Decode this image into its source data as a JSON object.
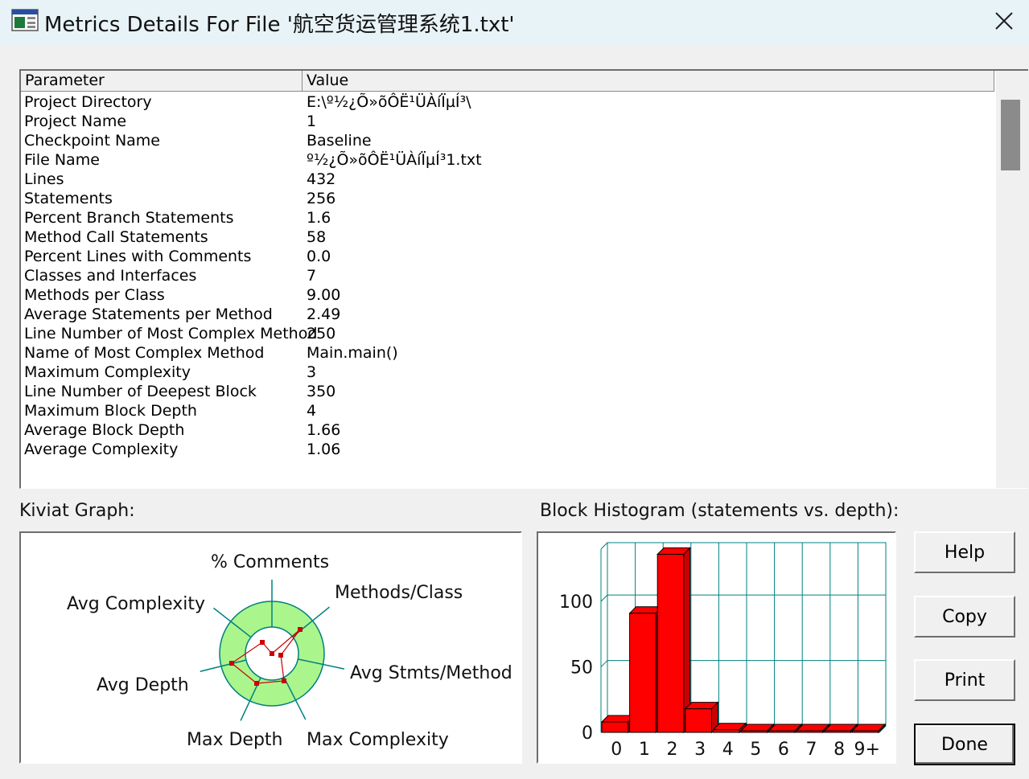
{
  "window": {
    "title": "Metrics Details For File '航空货运管理系统1.txt'",
    "close_icon": "close-icon"
  },
  "table": {
    "columns": [
      "Parameter",
      "Value"
    ],
    "rows": [
      {
        "param": "Project Directory",
        "value": "E:\\º½¿Õ»õÔË¹ÜÀíÏµÍ³\\"
      },
      {
        "param": "Project Name",
        "value": "1"
      },
      {
        "param": "Checkpoint Name",
        "value": "Baseline"
      },
      {
        "param": "File Name",
        "value": "º½¿Õ»õÔË¹ÜÀíÏµÍ³1.txt"
      },
      {
        "param": "Lines",
        "value": "432"
      },
      {
        "param": "Statements",
        "value": "256"
      },
      {
        "param": "Percent Branch Statements",
        "value": "1.6"
      },
      {
        "param": "Method Call Statements",
        "value": "58"
      },
      {
        "param": "Percent Lines with Comments",
        "value": "0.0"
      },
      {
        "param": "Classes and Interfaces",
        "value": "7"
      },
      {
        "param": "Methods per Class",
        "value": "9.00"
      },
      {
        "param": "Average Statements per Method",
        "value": "2.49"
      },
      {
        "param": "Line Number of Most Complex Method",
        "value": "250"
      },
      {
        "param": "Name of Most Complex Method",
        "value": "Main.main()"
      },
      {
        "param": "Maximum Complexity",
        "value": "3"
      },
      {
        "param": "Line Number of Deepest Block",
        "value": "350"
      },
      {
        "param": "Maximum Block Depth",
        "value": "4"
      },
      {
        "param": "Average Block Depth",
        "value": "1.66"
      },
      {
        "param": "Average Complexity",
        "value": "1.06"
      }
    ]
  },
  "kiviat": {
    "label": "Kiviat Graph:",
    "axes": [
      "% Comments",
      "Methods/Class",
      "Avg Stmts/Method",
      "Max Complexity",
      "Max Depth",
      "Avg Depth",
      "Avg Complexity"
    ],
    "colors": {
      "ring": "#aaf58c",
      "line": "#cc0000",
      "axis": "#008080"
    }
  },
  "histogram": {
    "label": "Block Histogram (statements vs. depth):"
  },
  "chart_data": {
    "type": "bar",
    "categories": [
      "0",
      "1",
      "2",
      "3",
      "4",
      "5",
      "6",
      "7",
      "8",
      "9+"
    ],
    "values": [
      8,
      91,
      136,
      18,
      2,
      0,
      0,
      0,
      0,
      0
    ],
    "yticks": [
      "0",
      "50",
      "100"
    ],
    "ylim": [
      0,
      140
    ],
    "grid": true,
    "bar_color": "#ff0000",
    "grid_color": "#008080"
  },
  "buttons": {
    "help": "Help",
    "copy": "Copy",
    "print": "Print",
    "done": "Done"
  }
}
